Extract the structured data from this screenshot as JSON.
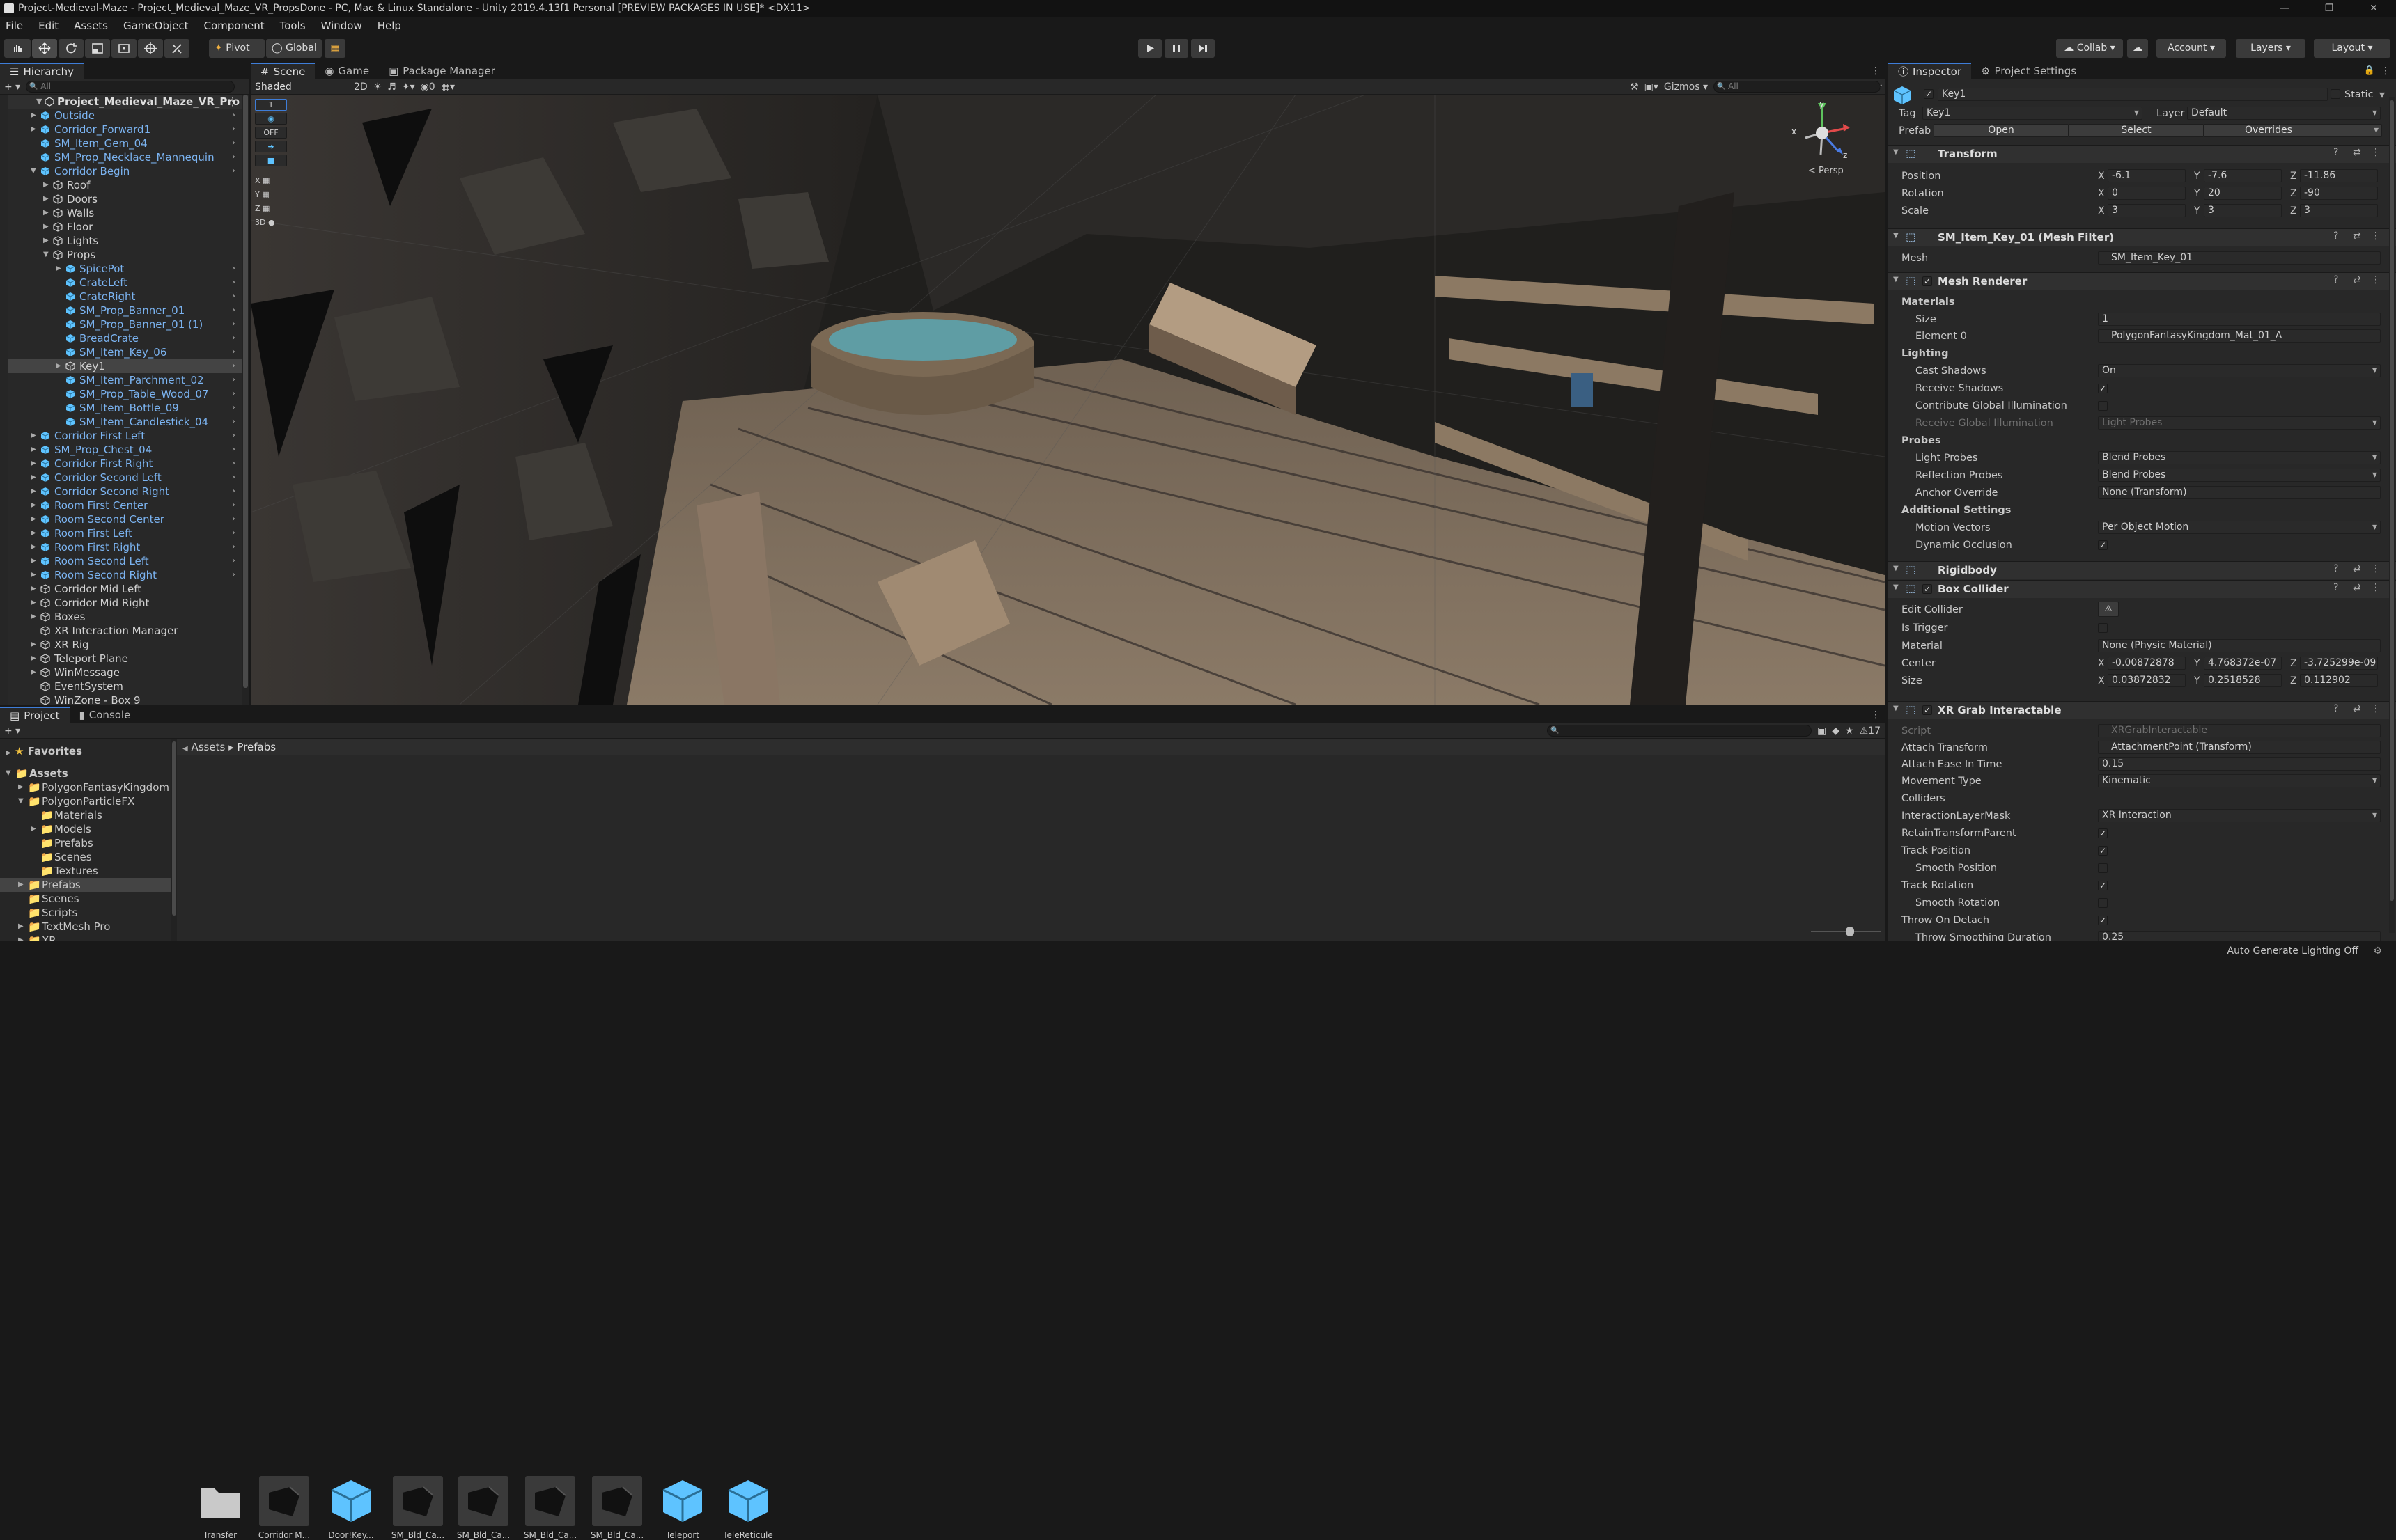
{
  "window": {
    "title": "Project-Medieval-Maze - Project_Medieval_Maze_VR_PropsDone - PC, Mac & Linux Standalone - Unity 2019.4.13f1 Personal [PREVIEW PACKAGES IN USE]* <DX11>",
    "min": "—",
    "max": "❐",
    "close": "✕"
  },
  "menu": [
    "File",
    "Edit",
    "Assets",
    "GameObject",
    "Component",
    "Tools",
    "Window",
    "Help"
  ],
  "toolbar": {
    "pivot": "Pivot",
    "global": "Global",
    "collab": "Collab ▾",
    "account": "Account",
    "layers": "Layers",
    "layout": "Layout"
  },
  "hierarchy": {
    "tab": "Hierarchy",
    "search": "All",
    "scene": "Project_Medieval_Maze_VR_Pro",
    "rows": [
      {
        "label": "Outside",
        "depth": 1,
        "arrow": "▶",
        "blue": true,
        "chev": true
      },
      {
        "label": "Corridor_Forward1",
        "depth": 1,
        "arrow": "▶",
        "blue": true,
        "chev": true
      },
      {
        "label": "SM_Item_Gem_04",
        "depth": 1,
        "arrow": "",
        "blue": true,
        "chev": true
      },
      {
        "label": "SM_Prop_Necklace_Mannequin",
        "depth": 1,
        "arrow": "",
        "blue": true,
        "chev": true
      },
      {
        "label": "Corridor Begin",
        "depth": 1,
        "arrow": "▼",
        "blue": true,
        "chev": true
      },
      {
        "label": "Roof",
        "depth": 2,
        "arrow": "▶",
        "blue": false,
        "chev": false
      },
      {
        "label": "Doors",
        "depth": 2,
        "arrow": "▶",
        "blue": false,
        "chev": false
      },
      {
        "label": "Walls",
        "depth": 2,
        "arrow": "▶",
        "blue": false,
        "chev": false
      },
      {
        "label": "Floor",
        "depth": 2,
        "arrow": "▶",
        "blue": false,
        "chev": false
      },
      {
        "label": "Lights",
        "depth": 2,
        "arrow": "▶",
        "blue": false,
        "chev": false
      },
      {
        "label": "Props",
        "depth": 2,
        "arrow": "▼",
        "blue": false,
        "chev": false
      },
      {
        "label": "SpicePot",
        "depth": 3,
        "arrow": "▶",
        "blue": true,
        "chev": true
      },
      {
        "label": "CrateLeft",
        "depth": 3,
        "arrow": "",
        "blue": true,
        "chev": true
      },
      {
        "label": "CrateRight",
        "depth": 3,
        "arrow": "",
        "blue": true,
        "chev": true
      },
      {
        "label": "SM_Prop_Banner_01",
        "depth": 3,
        "arrow": "",
        "blue": true,
        "chev": true
      },
      {
        "label": "SM_Prop_Banner_01 (1)",
        "depth": 3,
        "arrow": "",
        "blue": true,
        "chev": true
      },
      {
        "label": "BreadCrate",
        "depth": 3,
        "arrow": "",
        "blue": true,
        "chev": true
      },
      {
        "label": "SM_Item_Key_06",
        "depth": 3,
        "arrow": "",
        "blue": true,
        "chev": true
      },
      {
        "label": "Key1",
        "depth": 3,
        "arrow": "▶",
        "blue": false,
        "chev": true,
        "sel": true
      },
      {
        "label": "SM_Item_Parchment_02",
        "depth": 3,
        "arrow": "",
        "blue": true,
        "chev": true
      },
      {
        "label": "SM_Prop_Table_Wood_07",
        "depth": 3,
        "arrow": "",
        "blue": true,
        "chev": true
      },
      {
        "label": "SM_Item_Bottle_09",
        "depth": 3,
        "arrow": "",
        "blue": true,
        "chev": true
      },
      {
        "label": "SM_Item_Candlestick_04",
        "depth": 3,
        "arrow": "",
        "blue": true,
        "chev": true
      },
      {
        "label": "Corridor First Left",
        "depth": 1,
        "arrow": "▶",
        "blue": true,
        "chev": true
      },
      {
        "label": "SM_Prop_Chest_04",
        "depth": 1,
        "arrow": "▶",
        "blue": true,
        "chev": true
      },
      {
        "label": "Corridor First Right",
        "depth": 1,
        "arrow": "▶",
        "blue": true,
        "chev": true
      },
      {
        "label": "Corridor Second Left",
        "depth": 1,
        "arrow": "▶",
        "blue": true,
        "chev": true
      },
      {
        "label": "Corridor Second Right",
        "depth": 1,
        "arrow": "▶",
        "blue": true,
        "chev": true
      },
      {
        "label": "Room First Center",
        "depth": 1,
        "arrow": "▶",
        "blue": true,
        "chev": true
      },
      {
        "label": "Room Second Center",
        "depth": 1,
        "arrow": "▶",
        "blue": true,
        "chev": true
      },
      {
        "label": "Room First Left",
        "depth": 1,
        "arrow": "▶",
        "blue": true,
        "chev": true
      },
      {
        "label": "Room First Right",
        "depth": 1,
        "arrow": "▶",
        "blue": true,
        "chev": true
      },
      {
        "label": "Room Second Left",
        "depth": 1,
        "arrow": "▶",
        "blue": true,
        "chev": true
      },
      {
        "label": "Room Second Right",
        "depth": 1,
        "arrow": "▶",
        "blue": true,
        "chev": true
      },
      {
        "label": "Corridor Mid Left",
        "depth": 1,
        "arrow": "▶",
        "blue": false,
        "chev": false
      },
      {
        "label": "Corridor Mid Right",
        "depth": 1,
        "arrow": "▶",
        "blue": false,
        "chev": false
      },
      {
        "label": "Boxes",
        "depth": 1,
        "arrow": "▶",
        "blue": false,
        "chev": false
      },
      {
        "label": "XR Interaction Manager",
        "depth": 1,
        "arrow": "",
        "blue": false,
        "chev": false
      },
      {
        "label": "XR Rig",
        "depth": 1,
        "arrow": "▶",
        "blue": false,
        "chev": false
      },
      {
        "label": "Teleport Plane",
        "depth": 1,
        "arrow": "▶",
        "blue": false,
        "chev": false
      },
      {
        "label": "WinMessage",
        "depth": 1,
        "arrow": "▶",
        "blue": false,
        "chev": false
      },
      {
        "label": "EventSystem",
        "depth": 1,
        "arrow": "",
        "blue": false,
        "chev": false
      },
      {
        "label": "WinZone - Box 9",
        "depth": 1,
        "arrow": "",
        "blue": false,
        "chev": false
      }
    ]
  },
  "scene_tabs": {
    "scene": "Scene",
    "game": "Game",
    "package": "Package Manager"
  },
  "scene_toolbar": {
    "shading": "Shaded",
    "mode": "2D",
    "fx_count": "0",
    "gizmos": "Gizmos",
    "search": "All"
  },
  "scene_gizmo": {
    "persp": "< Persp",
    "x": "x",
    "y": "y",
    "z": "z"
  },
  "scene_overlay": [
    "1",
    "OFF",
    "X",
    "Y",
    "Z",
    "3D"
  ],
  "project": {
    "tab": "Project",
    "console": "Console",
    "favorites": "Favorites",
    "assets_root": "Assets",
    "breadcrumb": [
      "Assets",
      "Prefabs"
    ],
    "errors": "17",
    "tree": [
      {
        "label": "Assets",
        "depth": 0,
        "arrow": "▼",
        "bold": true
      },
      {
        "label": "PolygonFantasyKingdom",
        "depth": 1,
        "arrow": "▶"
      },
      {
        "label": "PolygonParticleFX",
        "depth": 1,
        "arrow": "▼"
      },
      {
        "label": "Materials",
        "depth": 2,
        "arrow": ""
      },
      {
        "label": "Models",
        "depth": 2,
        "arrow": "▶"
      },
      {
        "label": "Prefabs",
        "depth": 2,
        "arrow": ""
      },
      {
        "label": "Scenes",
        "depth": 2,
        "arrow": ""
      },
      {
        "label": "Textures",
        "depth": 2,
        "arrow": ""
      },
      {
        "label": "Prefabs",
        "depth": 1,
        "arrow": "▶",
        "sel": true
      },
      {
        "label": "Scenes",
        "depth": 1,
        "arrow": ""
      },
      {
        "label": "Scripts",
        "depth": 1,
        "arrow": ""
      },
      {
        "label": "TextMesh Pro",
        "depth": 1,
        "arrow": "▶"
      },
      {
        "label": "XR",
        "depth": 1,
        "arrow": "▶"
      }
    ],
    "assets": [
      {
        "label": "Transfer",
        "kind": "folder"
      },
      {
        "label": "Corridor M...",
        "kind": "dark"
      },
      {
        "label": "Door!Key...",
        "kind": "cube"
      },
      {
        "label": "SM_Bld_Ca...",
        "kind": "dark"
      },
      {
        "label": "SM_Bld_Ca...",
        "kind": "dark"
      },
      {
        "label": "SM_Bld_Ca...",
        "kind": "dark"
      },
      {
        "label": "SM_Bld_Ca...",
        "kind": "dark"
      },
      {
        "label": "Teleport",
        "kind": "cube"
      },
      {
        "label": "TeleReticule",
        "kind": "cube"
      }
    ]
  },
  "inspector": {
    "tab": "Inspector",
    "tab2": "Project Settings",
    "name": "Key1",
    "static": "Static",
    "tag_label": "Tag",
    "tag": "Key1",
    "layer_label": "Layer",
    "layer": "Default",
    "prefab_label": "Prefab",
    "open": "Open",
    "select": "Select",
    "overrides": "Overrides",
    "transform": {
      "title": "Transform",
      "position": "Position",
      "rotation": "Rotation",
      "scale": "Scale",
      "pos": [
        "-6.1",
        "-7.6",
        "-11.86"
      ],
      "rot": [
        "0",
        "20",
        "-90"
      ],
      "scl": [
        "3",
        "3",
        "3"
      ]
    },
    "meshfilter": {
      "title": "SM_Item_Key_01 (Mesh Filter)",
      "mesh_label": "Mesh",
      "mesh": "SM_Item_Key_01"
    },
    "meshrenderer": {
      "title": "Mesh Renderer",
      "materials": "Materials",
      "size_label": "Size",
      "size": "1",
      "element_label": "Element 0",
      "element": "PolygonFantasyKingdom_Mat_01_A",
      "lighting": "Lighting",
      "cast_label": "Cast Shadows",
      "cast": "On",
      "receive_label": "Receive Shadows",
      "contrib_label": "Contribute Global Illumination",
      "rgi_label": "Receive Global Illumination",
      "rgi": "Light Probes",
      "probes": "Probes",
      "lp_label": "Light Probes",
      "lp": "Blend Probes",
      "rp_label": "Reflection Probes",
      "rp": "Blend Probes",
      "anchor_label": "Anchor Override",
      "anchor": "None (Transform)",
      "additional": "Additional Settings",
      "motion_label": "Motion Vectors",
      "motion": "Per Object Motion",
      "dyn_label": "Dynamic Occlusion"
    },
    "rigidbody": {
      "title": "Rigidbody"
    },
    "boxcollider": {
      "title": "Box Collider",
      "edit_label": "Edit Collider",
      "trigger_label": "Is Trigger",
      "material_label": "Material",
      "material": "None (Physic Material)",
      "center_label": "Center",
      "size_label": "Size",
      "center": [
        "-0.00872878",
        "4.768372e-07",
        "-3.725299e-09"
      ],
      "size": [
        "0.03872832",
        "0.2518528",
        "0.112902"
      ]
    },
    "xrgrab": {
      "title": "XR Grab Interactable",
      "script_label": "Script",
      "script": "XRGrabInteractable",
      "attach_label": "Attach Transform",
      "attach": "AttachmentPoint (Transform)",
      "ease_label": "Attach Ease In Time",
      "ease": "0.15",
      "movement_label": "Movement Type",
      "movement": "Kinematic",
      "colliders_label": "Colliders",
      "mask_label": "InteractionLayerMask",
      "mask": "XR Interaction",
      "retain_label": "RetainTransformParent",
      "trackpos_label": "Track Position",
      "smoothpos_label": "Smooth Position",
      "trackrot_label": "Track Rotation",
      "smoothrot_label": "Smooth Rotation",
      "throw_label": "Throw On Detach",
      "throwsmooth_label": "Throw Smoothing Duration",
      "throwsmooth": "0.25"
    }
  },
  "status": {
    "right": "Auto Generate Lighting Off"
  },
  "colors": {
    "accent": "#3e7dd8",
    "selected": "#444444",
    "prefab_blue": "#7bb3f0",
    "cube": "#5ec3ff"
  }
}
